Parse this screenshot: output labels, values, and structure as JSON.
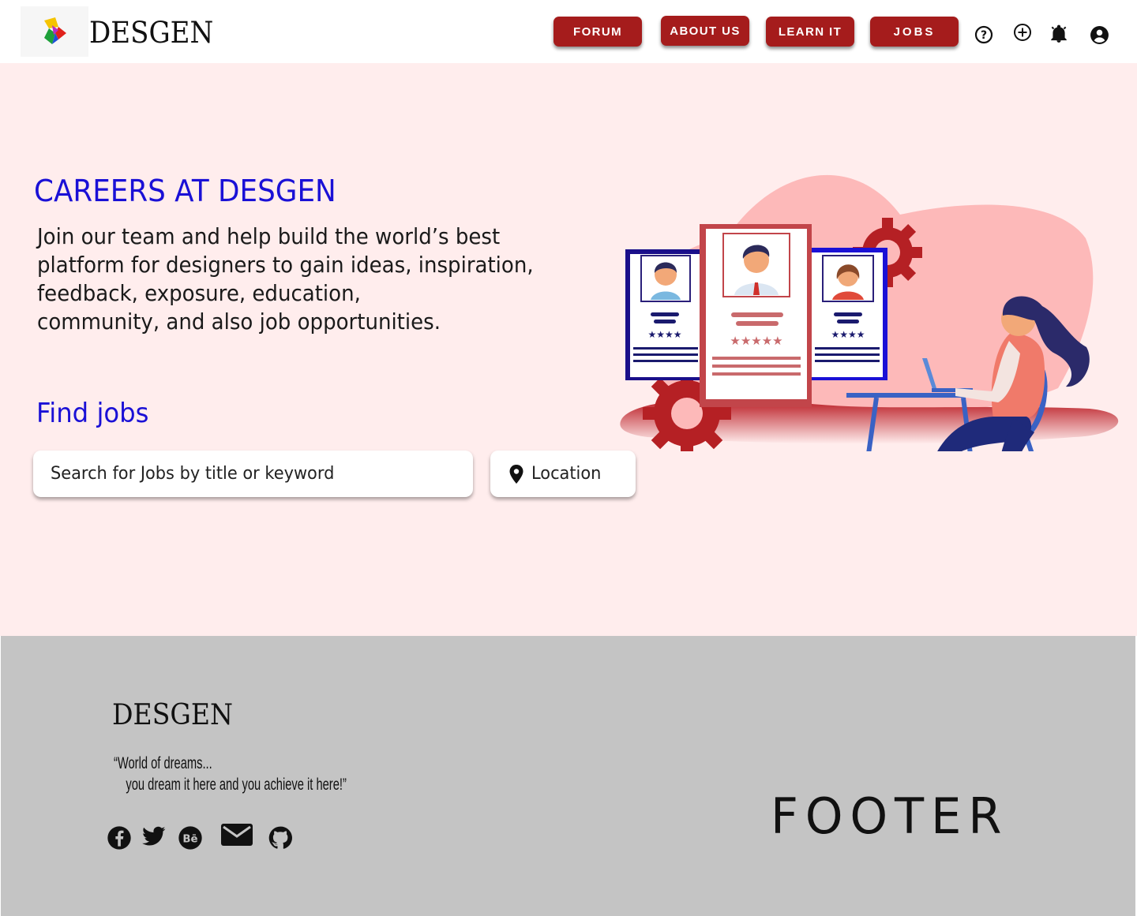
{
  "header": {
    "brand": "DESGEN",
    "nav": [
      {
        "label": "FORUM"
      },
      {
        "label": "ABOUT US"
      },
      {
        "label": "LEARN IT"
      },
      {
        "label": "JOBS"
      }
    ],
    "icons": [
      "help-icon",
      "add-icon",
      "notification-bell-icon",
      "account-icon"
    ]
  },
  "hero": {
    "title": "CAREERS AT DESGEN",
    "description_lines": [
      "Join our team and help build the world’s best",
      "platform for  designers to gain ideas, inspiration,",
      "feedback, exposure, education,",
      "community, and also job opportunities."
    ],
    "find_jobs": "Find jobs",
    "search_placeholder": "Search for Jobs by title or keyword",
    "location_placeholder": "Location"
  },
  "footer": {
    "brand": "DESGEN",
    "tagline_line1": "“World of dreams...",
    "tagline_line2": "you dream it here and you achieve it here!”",
    "social_icons": [
      "facebook-icon",
      "twitter-icon",
      "behance-icon",
      "mail-icon",
      "github-icon"
    ],
    "footer_word": "FOOTER"
  },
  "colors": {
    "brand_red": "#a51c1c",
    "hero_bg": "#ffeded",
    "accent_blue": "#1a10d6",
    "footer_bg": "#c4c4c4"
  }
}
